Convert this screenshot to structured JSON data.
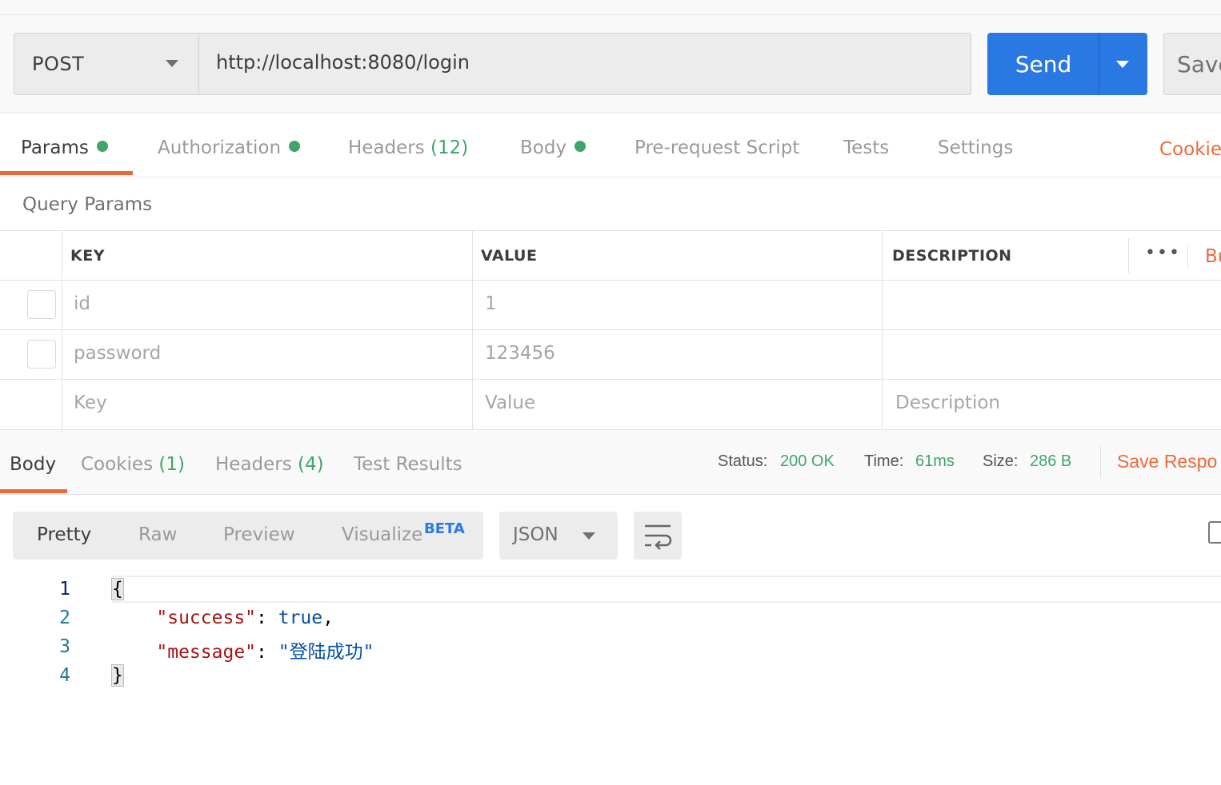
{
  "request": {
    "method": "POST",
    "url": "http://localhost:8080/login",
    "send_label": "Send",
    "save_label": "Save"
  },
  "request_tabs": [
    {
      "label": "Params",
      "dot": true
    },
    {
      "label": "Authorization",
      "dot": true
    },
    {
      "label": "Headers",
      "count": "(12)"
    },
    {
      "label": "Body",
      "dot": true
    },
    {
      "label": "Pre-request Script"
    },
    {
      "label": "Tests"
    },
    {
      "label": "Settings"
    }
  ],
  "cookies_link": "Cookie",
  "query_params": {
    "title": "Query Params",
    "columns": [
      "KEY",
      "VALUE",
      "DESCRIPTION"
    ],
    "more": "•••",
    "bulk_edit": "Bu",
    "rows": [
      {
        "key": "id",
        "value": "1",
        "description": ""
      },
      {
        "key": "password",
        "value": "123456",
        "description": ""
      }
    ],
    "placeholder": {
      "key": "Key",
      "value": "Value",
      "description": "Description"
    }
  },
  "response": {
    "tabs": [
      {
        "label": "Body"
      },
      {
        "label": "Cookies",
        "count": "(1)"
      },
      {
        "label": "Headers",
        "count": "(4)"
      },
      {
        "label": "Test Results"
      }
    ],
    "status_label": "Status:",
    "status_value": "200 OK",
    "time_label": "Time:",
    "time_value": "61ms",
    "size_label": "Size:",
    "size_value": "286 B",
    "save_response": "Save Respo",
    "view_tabs": [
      "Pretty",
      "Raw",
      "Preview",
      "Visualize"
    ],
    "beta": "BETA",
    "format": "JSON",
    "code_lines": [
      "1",
      "2",
      "3",
      "4"
    ],
    "json": {
      "open": "{",
      "key1": "\"success\"",
      "val1": "true",
      "key2": "\"message\"",
      "val2": "\"登陆成功\"",
      "close": "}"
    }
  },
  "colors": {
    "accent": "#ea6a3d",
    "send": "#2a79e3",
    "success": "#3fa66a"
  }
}
